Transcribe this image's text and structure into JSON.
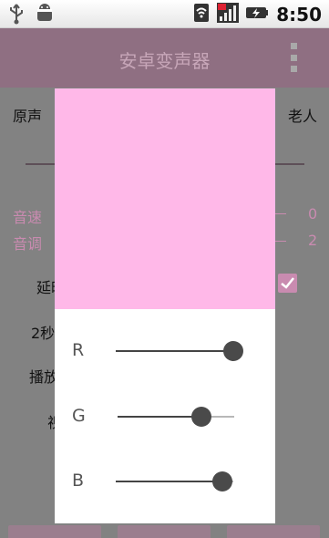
{
  "status_bar": {
    "left_icons": [
      "usb-icon",
      "android-debug-icon"
    ],
    "right_icons": [
      "wifi-icon",
      "signal-icon",
      "battery-charging-icon"
    ],
    "time": "8:50"
  },
  "app": {
    "title": "安卓变声器",
    "overflow_icon": "overflow-menu-icon"
  },
  "background": {
    "voice_original": "原声",
    "voice_old": "老人",
    "speed_label": "音速",
    "speed_value": "0",
    "pitch_label": "音调",
    "pitch_value": "2",
    "delay_label_partial": "延时",
    "two_seconds_partial": "2秒",
    "play_partial": "播放",
    "fourth_partial": "视",
    "checkbox_checked": true
  },
  "dialog": {
    "preview_color": "#ffb8e8",
    "sliders": [
      {
        "label": "R",
        "value": 255,
        "max": 255
      },
      {
        "label": "G",
        "value": 184,
        "max": 255
      },
      {
        "label": "B",
        "value": 232,
        "max": 255
      }
    ]
  },
  "colors": {
    "overlay_bg": "#828282",
    "title_bar": "#8f6f82",
    "accent_pink": "#c98bb0",
    "thumb": "#4a4a4a"
  }
}
